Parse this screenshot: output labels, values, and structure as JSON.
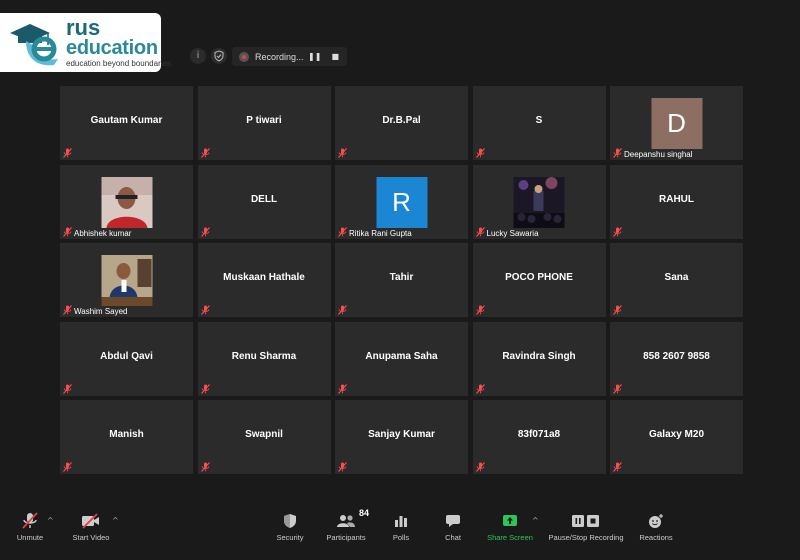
{
  "logo": {
    "line1": "rus",
    "line2": "education",
    "tagline": "education beyond boundaries",
    "icon": "graduation-cap-e-logo",
    "colors": {
      "primary": "#1a6a7a",
      "accent": "#5fbcd3"
    }
  },
  "top_bar": {
    "info_icon": "info-icon",
    "shield_icon": "security-shield-icon",
    "recording_label": "Recording...",
    "pause_glyph": "❚❚",
    "stop_glyph": "■"
  },
  "participants": [
    {
      "name": "Gautam Kumar",
      "mode": "name"
    },
    {
      "name": "P tiwari",
      "mode": "name"
    },
    {
      "name": "Dr.B.Pal",
      "mode": "name"
    },
    {
      "name": "S",
      "mode": "name"
    },
    {
      "name": "Deepanshu singhal",
      "mode": "avatar",
      "initial": "D",
      "color": "#8c6e62"
    },
    {
      "name": "Abhishek kumar",
      "mode": "photo",
      "photo": "person-red-shirt"
    },
    {
      "name": "DELL",
      "mode": "name"
    },
    {
      "name": "Ritika Rani Gupta",
      "mode": "avatar",
      "initial": "R",
      "color": "#1b86d4"
    },
    {
      "name": "Lucky Sawaria",
      "mode": "photo",
      "photo": "concert-crowd"
    },
    {
      "name": "RAHUL",
      "mode": "name"
    },
    {
      "name": "Washim Sayed",
      "mode": "photo",
      "photo": "man-at-desk"
    },
    {
      "name": "Muskaan Hathale",
      "mode": "name"
    },
    {
      "name": "Tahir",
      "mode": "name"
    },
    {
      "name": "POCO PHONE",
      "mode": "name"
    },
    {
      "name": "Sana",
      "mode": "name"
    },
    {
      "name": "Abdul Qavi",
      "mode": "name"
    },
    {
      "name": "Renu Sharma",
      "mode": "name"
    },
    {
      "name": "Anupama Saha",
      "mode": "name"
    },
    {
      "name": "Ravindra Singh",
      "mode": "name"
    },
    {
      "name": "858 2607 9858",
      "mode": "name"
    },
    {
      "name": "Manish",
      "mode": "name"
    },
    {
      "name": "Swapnil",
      "mode": "name"
    },
    {
      "name": "Sanjay Kumar",
      "mode": "name"
    },
    {
      "name": "83f071a8",
      "mode": "name"
    },
    {
      "name": "Galaxy M20",
      "mode": "name"
    }
  ],
  "toolbar": {
    "unmute": "Unmute",
    "start_video": "Start Video",
    "security": "Security",
    "participants": "Participants",
    "participants_count": "84",
    "polls": "Polls",
    "chat": "Chat",
    "share_screen": "Share Screen",
    "pause_stop_recording": "Pause/Stop Recording",
    "reactions": "Reactions",
    "caret": "^",
    "accent_green": "#2dc55a"
  }
}
